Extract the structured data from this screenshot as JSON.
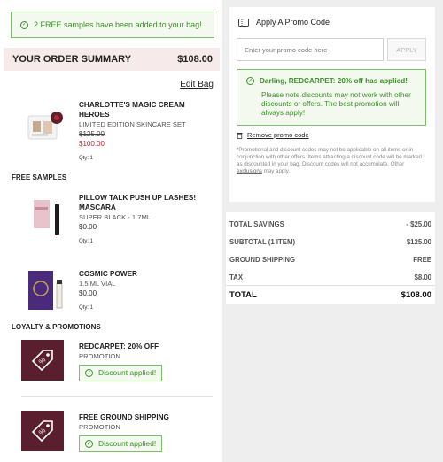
{
  "notification": {
    "text": "2 FREE samples have been added to your bag!"
  },
  "summary": {
    "title": "YOUR ORDER SUMMARY",
    "total": "$108.00"
  },
  "edit_bag": "Edit Bag",
  "products": [
    {
      "name": "CHARLOTTE'S MAGIC CREAM HEROES",
      "variant": "LIMITED EDITION SKINCARE SET",
      "original_price": "$125.00",
      "price": "$100.00",
      "qty": "Qty: 1"
    }
  ],
  "free_samples": {
    "title": "FREE SAMPLES",
    "items": [
      {
        "name": "PILLOW TALK PUSH UP LASHES! MASCARA",
        "variant": "SUPER BLACK - 1.7ML",
        "price": "$0.00",
        "qty": "Qty: 1"
      },
      {
        "name": "COSMIC POWER",
        "variant": "1.5 ML VIAL",
        "price": "$0.00",
        "qty": "Qty: 1"
      }
    ]
  },
  "loyalty": {
    "title": "LOYALTY & PROMOTIONS",
    "items": [
      {
        "name": "REDCARPET: 20% OFF",
        "type": "PROMOTION",
        "status": "Discount applied!"
      },
      {
        "name": "FREE GROUND SHIPPING",
        "type": "PROMOTION",
        "status": "Discount applied!"
      }
    ]
  },
  "promo": {
    "title": "Apply A Promo Code",
    "placeholder": "Enter your promo code here",
    "apply_label": "APPLY",
    "success_title": "Darling, REDCARPET: 20% off has applied!",
    "success_body": "Please note discounts may not work with other discounts or offers. The best promotion will always apply!",
    "remove_label": "Remove promo code",
    "fineprint_a": "*Promotional and discount codes may not be applicable on all items or in conjunction with other offers. Items attracting a discount code will be marked as discounted in your bag. Discount codes will not accumulate. Other",
    "fineprint_link": "exclusions",
    "fineprint_b": "may apply."
  },
  "totals": {
    "savings_label": "TOTAL SAVINGS",
    "savings_value": "- $25.00",
    "subtotal_label": "SUBTOTAL (1 ITEM)",
    "subtotal_value": "$125.00",
    "shipping_label": "GROUND SHIPPING",
    "shipping_value": "FREE",
    "tax_label": "TAX",
    "tax_value": "$8.00",
    "total_label": "TOTAL",
    "total_value": "$108.00"
  },
  "colors": {
    "success_green": "#3f8f2c",
    "sale_red": "#c0272d",
    "summary_bar": "#f7eaea",
    "promo_tile": "#5a1f2e"
  }
}
